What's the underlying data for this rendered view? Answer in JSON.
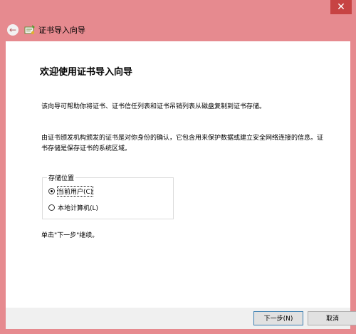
{
  "window": {
    "close_glyph": "✕"
  },
  "nav": {
    "back_glyph": "←",
    "title": "证书导入向导",
    "icon": "certificate-icon"
  },
  "page": {
    "title": "欢迎使用证书导入向导",
    "desc1": "该向导可帮助你将证书、证书信任列表和证书吊销列表从磁盘复制到证书存储。",
    "desc2": "由证书颁发机构颁发的证书是对你身份的确认，它包含用来保护数据或建立安全网络连接的信息。证书存储是保存证书的系统区域。",
    "storage": {
      "label": "存储位置",
      "options": [
        {
          "label": "当前用户(C)",
          "checked": true
        },
        {
          "label": "本地计算机(L)",
          "checked": false
        }
      ]
    },
    "hint": "单击\"下一步\"继续。"
  },
  "footer": {
    "next_label": "下一步(N)",
    "cancel_label": "取消"
  }
}
